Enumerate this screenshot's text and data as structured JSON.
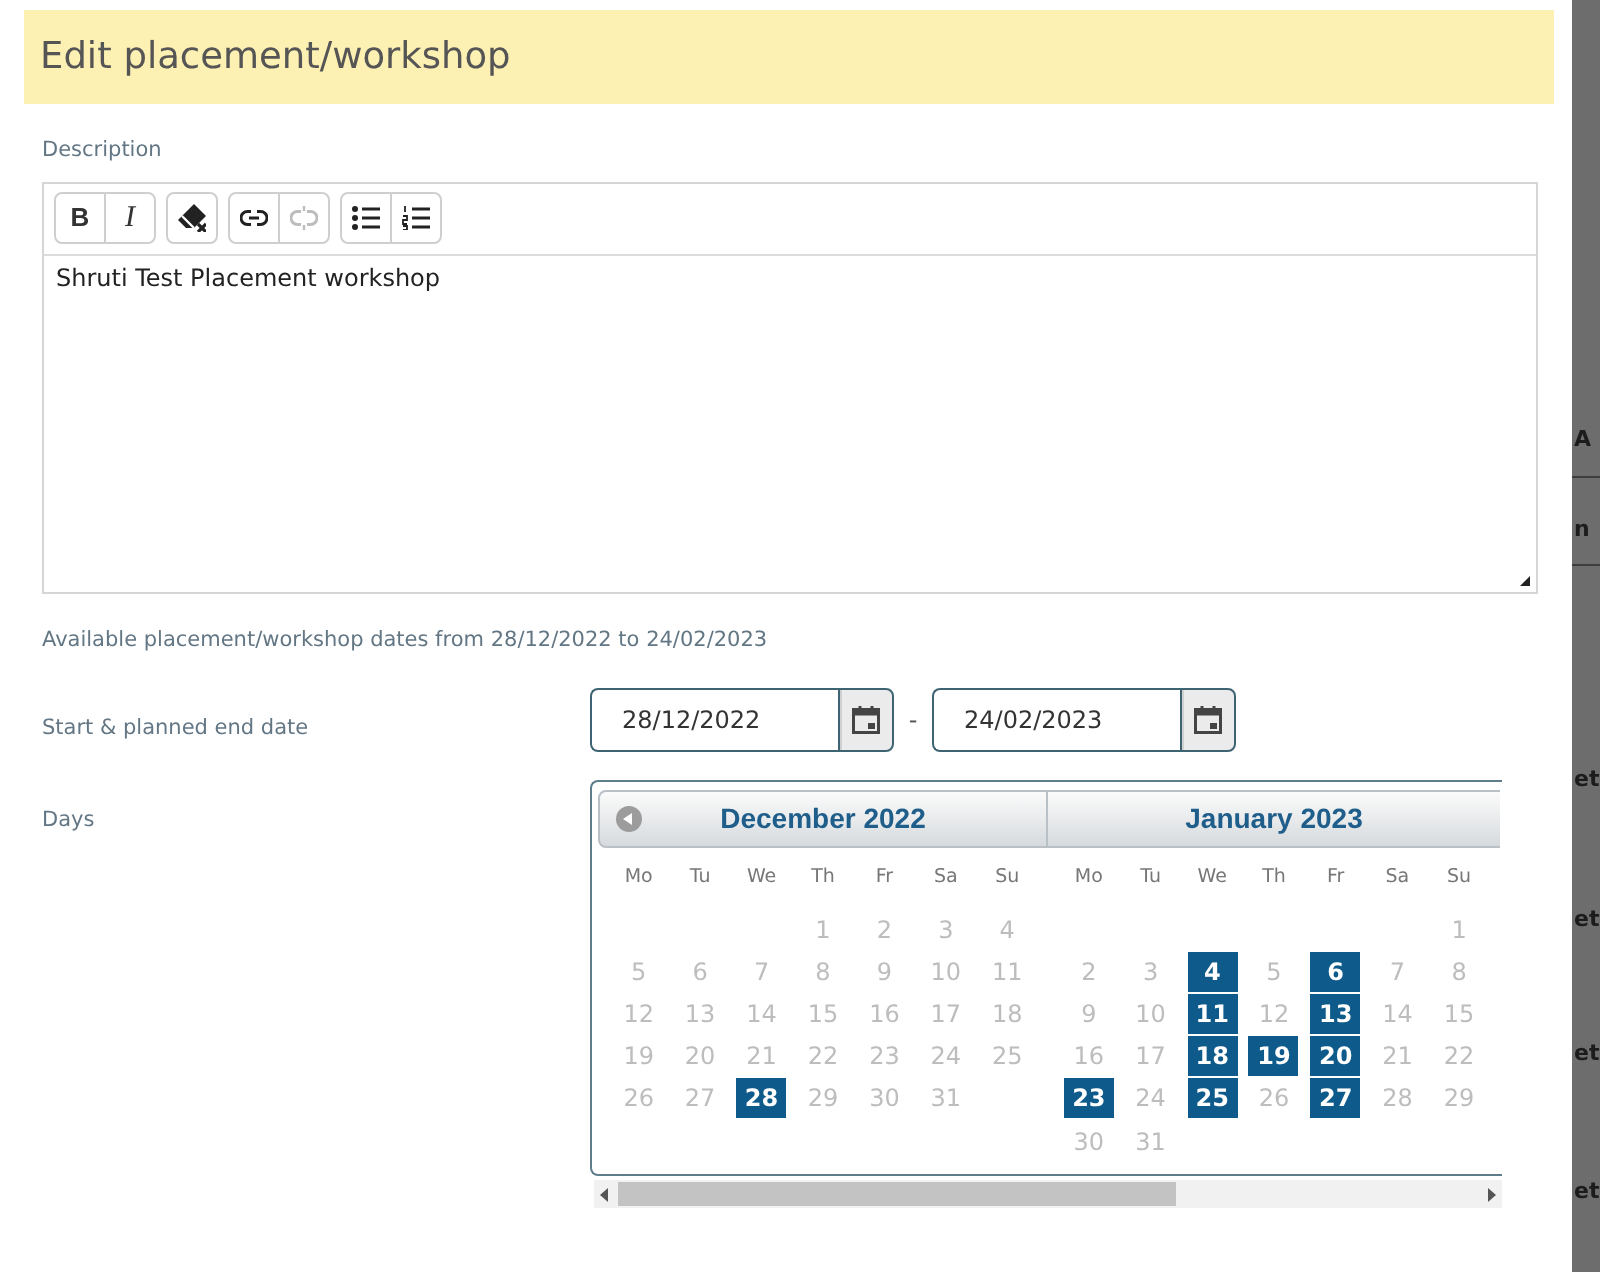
{
  "dialog": {
    "title": "Edit placement/workshop"
  },
  "description": {
    "label": "Description",
    "toolbar": [
      {
        "buttons": [
          {
            "kind": "bold",
            "label": "B",
            "disabled": false
          },
          {
            "kind": "italic",
            "label": "I",
            "disabled": false
          }
        ]
      },
      {
        "buttons": [
          {
            "kind": "eraser",
            "disabled": false
          }
        ]
      },
      {
        "buttons": [
          {
            "kind": "link",
            "disabled": false
          },
          {
            "kind": "unlink",
            "disabled": true
          }
        ]
      },
      {
        "buttons": [
          {
            "kind": "bullets",
            "disabled": false
          },
          {
            "kind": "numbering",
            "disabled": false
          }
        ]
      }
    ],
    "value": "Shruti Test Placement workshop"
  },
  "availability_note": "Available placement/workshop dates from 28/12/2022 to 24/02/2023",
  "date_range": {
    "label": "Start & planned end date",
    "start": "28/12/2022",
    "separator": "-",
    "end": "24/02/2023"
  },
  "calendar": {
    "label": "Days",
    "months": [
      {
        "title": "December 2022",
        "previous_button": true,
        "weekdays": [
          "Mo",
          "Tu",
          "We",
          "Th",
          "Fr",
          "Sa",
          "Su"
        ],
        "weeks": [
          {
            "days": [
              {
                "day": "1",
                "selected": false
              },
              {
                "day": "2",
                "selected": false
              },
              {
                "day": "3",
                "selected": false
              },
              {
                "day": "4",
                "selected": false
              }
            ]
          },
          {
            "days": [
              {
                "day": "5",
                "selected": false
              },
              {
                "day": "6",
                "selected": false
              },
              {
                "day": "7",
                "selected": false
              },
              {
                "day": "8",
                "selected": false
              },
              {
                "day": "9",
                "selected": false
              },
              {
                "day": "10",
                "selected": false
              },
              {
                "day": "11",
                "selected": false
              }
            ]
          },
          {
            "days": [
              {
                "day": "12",
                "selected": false
              },
              {
                "day": "13",
                "selected": false
              },
              {
                "day": "14",
                "selected": false
              },
              {
                "day": "15",
                "selected": false
              },
              {
                "day": "16",
                "selected": false
              },
              {
                "day": "17",
                "selected": false
              },
              {
                "day": "18",
                "selected": false
              }
            ]
          },
          {
            "days": [
              {
                "day": "19",
                "selected": false
              },
              {
                "day": "20",
                "selected": false
              },
              {
                "day": "21",
                "selected": false
              },
              {
                "day": "22",
                "selected": false
              },
              {
                "day": "23",
                "selected": false
              },
              {
                "day": "24",
                "selected": false
              },
              {
                "day": "25",
                "selected": false
              }
            ]
          },
          {
            "days": [
              {
                "day": "26",
                "selected": false
              },
              {
                "day": "27",
                "selected": false
              },
              {
                "day": "28",
                "selected": true
              },
              {
                "day": "29",
                "selected": false
              },
              {
                "day": "30",
                "selected": false
              },
              {
                "day": "31",
                "selected": false
              }
            ]
          }
        ]
      },
      {
        "title": "January 2023",
        "previous_button": false,
        "weekdays": [
          "Mo",
          "Tu",
          "We",
          "Th",
          "Fr",
          "Sa",
          "Su"
        ],
        "weeks": [
          {
            "days": [
              {
                "day": "1",
                "selected": false
              }
            ]
          },
          {
            "days": [
              {
                "day": "2",
                "selected": false
              },
              {
                "day": "3",
                "selected": false
              },
              {
                "day": "4",
                "selected": true
              },
              {
                "day": "5",
                "selected": false
              },
              {
                "day": "6",
                "selected": true
              },
              {
                "day": "7",
                "selected": false
              },
              {
                "day": "8",
                "selected": false
              }
            ]
          },
          {
            "days": [
              {
                "day": "9",
                "selected": false
              },
              {
                "day": "10",
                "selected": false
              },
              {
                "day": "11",
                "selected": true
              },
              {
                "day": "12",
                "selected": false
              },
              {
                "day": "13",
                "selected": true
              },
              {
                "day": "14",
                "selected": false
              },
              {
                "day": "15",
                "selected": false
              }
            ]
          },
          {
            "days": [
              {
                "day": "16",
                "selected": false
              },
              {
                "day": "17",
                "selected": false
              },
              {
                "day": "18",
                "selected": true
              },
              {
                "day": "19",
                "selected": true
              },
              {
                "day": "20",
                "selected": true
              },
              {
                "day": "21",
                "selected": false
              },
              {
                "day": "22",
                "selected": false
              }
            ]
          },
          {
            "days": [
              {
                "day": "23",
                "selected": true
              },
              {
                "day": "24",
                "selected": false
              },
              {
                "day": "25",
                "selected": true
              },
              {
                "day": "26",
                "selected": false
              },
              {
                "day": "27",
                "selected": true
              },
              {
                "day": "28",
                "selected": false
              },
              {
                "day": "29",
                "selected": false
              }
            ]
          },
          {
            "days": [
              {
                "day": "30",
                "selected": false
              },
              {
                "day": "31",
                "selected": false
              }
            ]
          }
        ]
      }
    ]
  },
  "background_page": {
    "texts": [
      "A",
      "n",
      "et",
      "et",
      "et",
      "et"
    ]
  }
}
